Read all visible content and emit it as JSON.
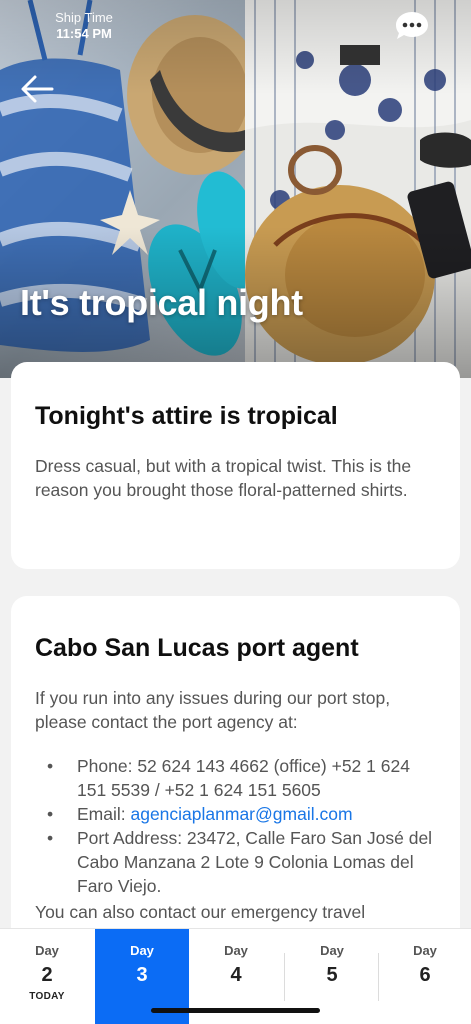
{
  "status_bar": {
    "label": "Ship Time",
    "time": "11:54 PM"
  },
  "icons": {
    "back": "arrow-left-icon",
    "chat": "chat-bubble-icon"
  },
  "hero": {
    "title": "It's tropical night"
  },
  "attire_card": {
    "heading": "Tonight's attire is tropical",
    "body": "Dress casual, but with a tropical twist. This is the reason you brought those floral-patterned shirts."
  },
  "port_card": {
    "heading": "Cabo San Lucas port agent",
    "intro": "If you run into any issues during our port stop, please contact the port agency at:",
    "phone": "Phone: 52 624 143 4662 (office) +52 1 624 151 5539 / +52 1 624 151 5605",
    "email_label": "Email: ",
    "email": "agenciaplanmar@gmail.com",
    "address": "Port Address: 23472, Calle Faro San José del Cabo Manzana 2 Lote 9 Colonia Lomas del Faro Viejo.",
    "outro": "You can also contact our emergency travel"
  },
  "day_bar": {
    "days": [
      {
        "label": "Day",
        "number": "2",
        "sub": "TODAY"
      },
      {
        "label": "Day",
        "number": "3",
        "sub": ""
      },
      {
        "label": "Day",
        "number": "4",
        "sub": ""
      },
      {
        "label": "Day",
        "number": "5",
        "sub": ""
      },
      {
        "label": "Day",
        "number": "6",
        "sub": ""
      }
    ],
    "selected_index": 1
  },
  "colors": {
    "accent": "#0b6cf5",
    "link": "#1976e6",
    "background": "#f2f2f2"
  }
}
